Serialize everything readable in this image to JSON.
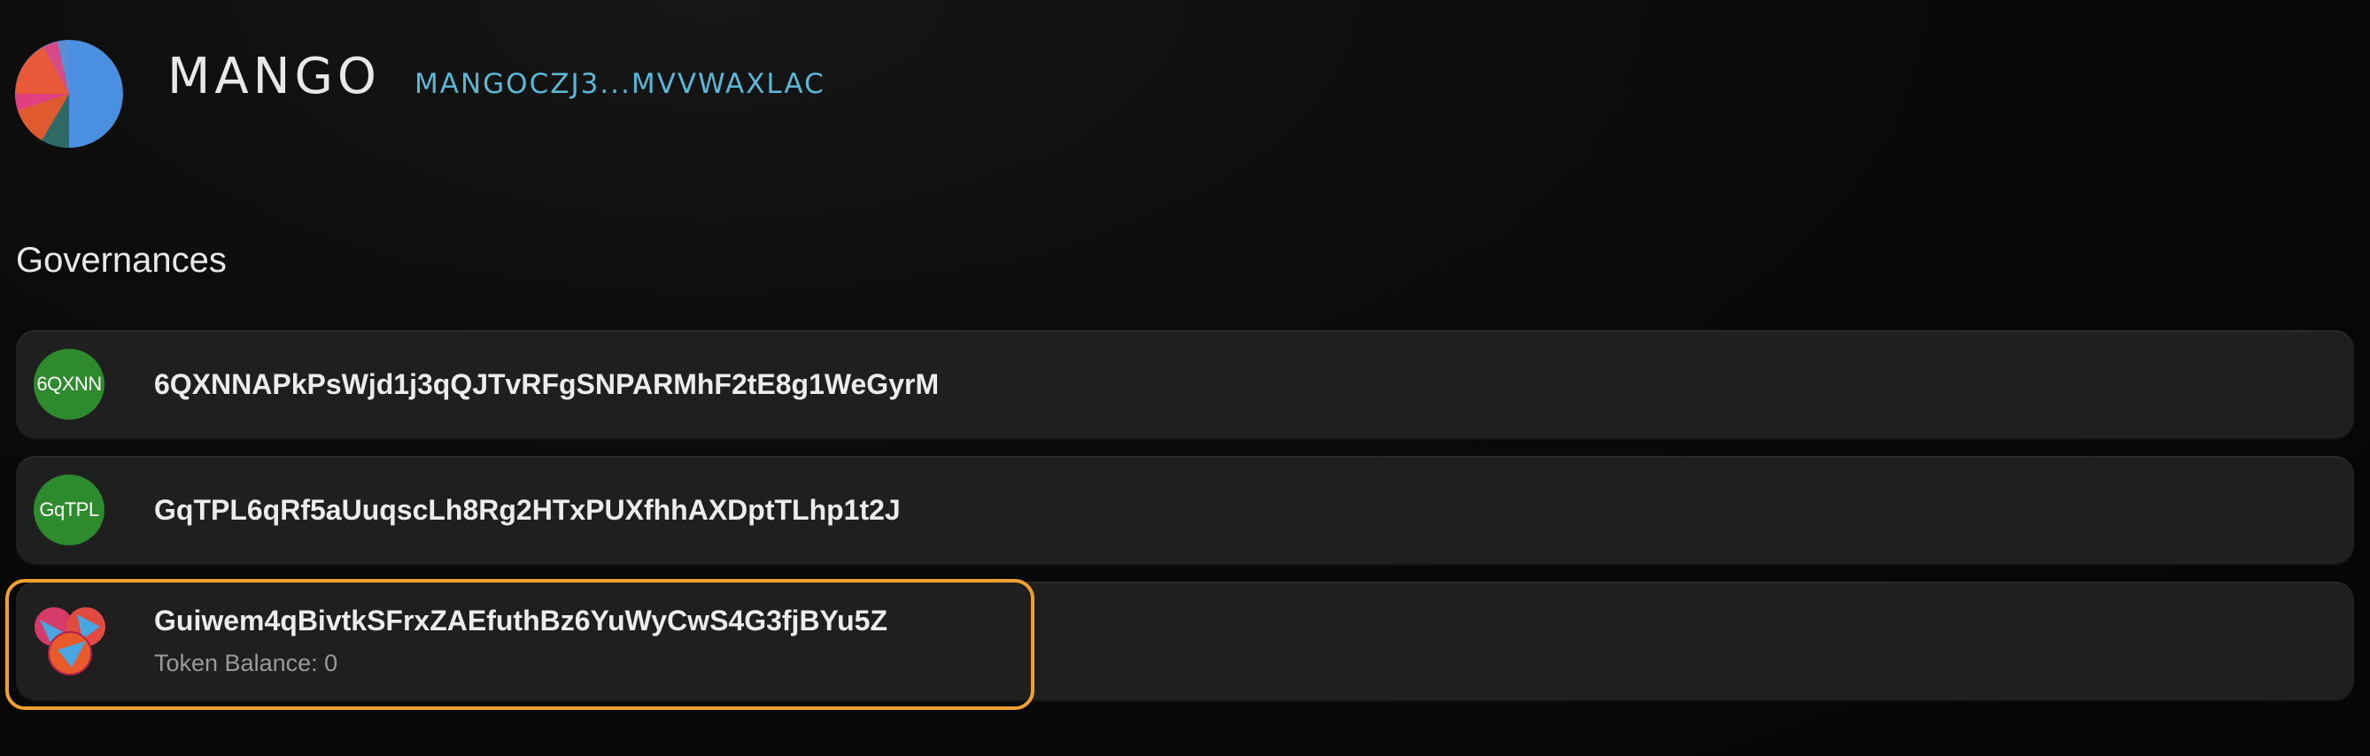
{
  "header": {
    "title": "MANGO",
    "address": "MANGOCZJ3...MVVWAXLAC",
    "logo_icon": "mango-pie-logo-icon"
  },
  "section": {
    "title": "Governances"
  },
  "governances": [
    {
      "avatar_text": "6QXNN",
      "name": "6QXNNAPkPsWjd1j3qQJTvRFgSNPARMhF2tE8g1WeGyrM",
      "sub": ""
    },
    {
      "avatar_text": "GqTPL",
      "name": "GqTPL6qRf5aUuqscLh8Rg2HTxPUXfhhAXDptTLhp1t2J",
      "sub": ""
    },
    {
      "avatar_text": "",
      "avatar_icon": "token-cluster-icon",
      "name": "Guiwem4qBivtkSFrxZAEfuthBz6YuWyCwS4G3fjBYu5Z",
      "sub": "Token Balance: 0"
    }
  ],
  "colors": {
    "background": "#0a0a0a",
    "row_background": "#1f1f1f",
    "address_accent": "#5bb7d6",
    "avatar_green": "#2d8a2d",
    "highlight": "#f0a030"
  }
}
